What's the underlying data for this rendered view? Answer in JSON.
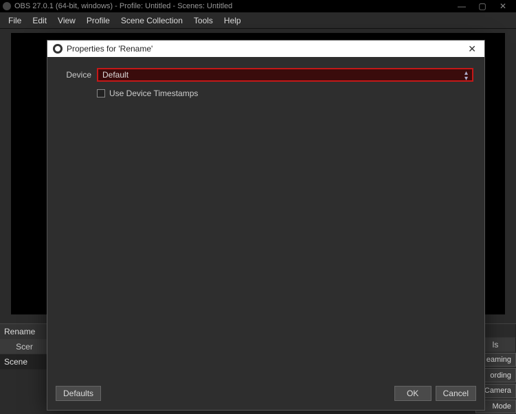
{
  "titlebar": {
    "title": "OBS 27.0.1 (64-bit, windows) - Profile: Untitled - Scenes: Untitled"
  },
  "menubar": {
    "items": [
      "File",
      "Edit",
      "View",
      "Profile",
      "Scene Collection",
      "Tools",
      "Help"
    ]
  },
  "docks": {
    "sources_item": "Rename",
    "scenes_header": "Scer",
    "scenes_item": "Scene",
    "controls_header": "ls",
    "controls": {
      "streaming": "eaming",
      "recording": "ording",
      "camera": "l Camera",
      "mode": "Mode"
    }
  },
  "dialog": {
    "title": "Properties for 'Rename'",
    "device_label": "Device",
    "device_value": "Default",
    "timestamps_label": "Use Device Timestamps",
    "defaults": "Defaults",
    "ok": "OK",
    "cancel": "Cancel"
  }
}
